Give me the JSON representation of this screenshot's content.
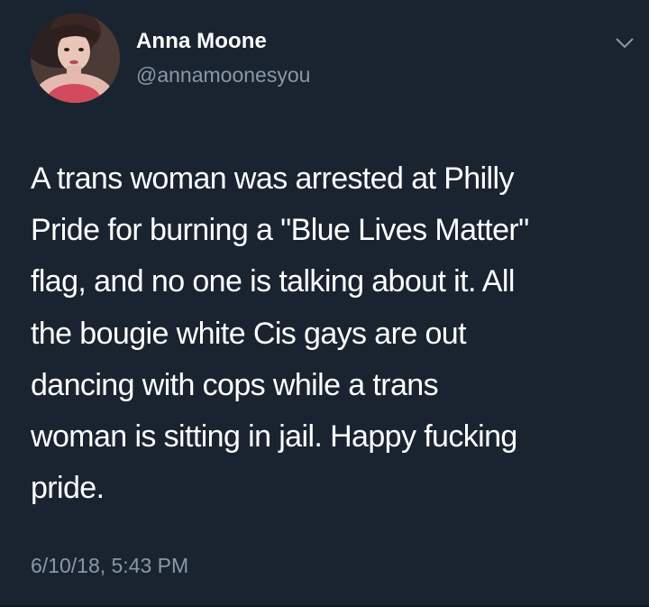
{
  "user": {
    "display_name": "Anna Moone",
    "handle": "@annamoonesyou",
    "avatar_icon": "profile-photo"
  },
  "menu": {
    "icon": "chevron-down-icon"
  },
  "tweet": {
    "lines": [
      "A trans woman was arrested at Philly",
      "Pride for burning a \"Blue Lives Matter\"",
      "flag, and no one is talking about it. All",
      "the bougie white Cis gays are out",
      "dancing with cops while a trans",
      "woman is sitting in jail. Happy fucking",
      "pride."
    ],
    "timestamp": "6/10/18, 5:43 PM"
  },
  "colors": {
    "background": "#1a2430",
    "primary_text": "#ffffff",
    "secondary_text": "#8899a6"
  }
}
